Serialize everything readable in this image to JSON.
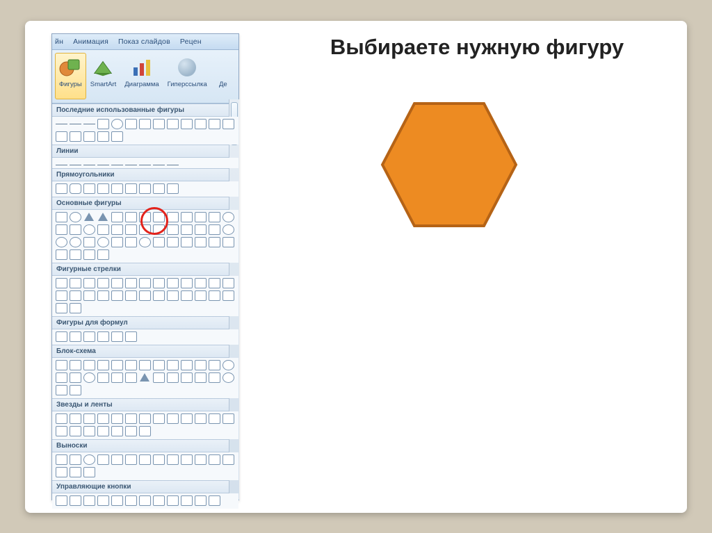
{
  "heading": "Выбираете нужную фигуру",
  "tabs": {
    "t1": "йн",
    "t2": "Анимация",
    "t3": "Показ слайдов",
    "t4": "Рецен"
  },
  "ribbon": {
    "shapes": "Фигуры",
    "smartart": "SmartArt",
    "chart": "Диаграмма",
    "hyperlink": "Гиперссылка",
    "action": "Де"
  },
  "groups": {
    "recent": "Последние использованные фигуры",
    "lines": "Линии",
    "rects": "Прямоугольники",
    "basic": "Основные фигуры",
    "arrows": "Фигурные стрелки",
    "equation": "Фигуры для формул",
    "flowchart": "Блок-схема",
    "stars": "Звезды и ленты",
    "callouts": "Выноски",
    "actionbtns": "Управляющие кнопки"
  },
  "hexagon": {
    "fill": "#ed8b22",
    "stroke": "#b56316"
  }
}
